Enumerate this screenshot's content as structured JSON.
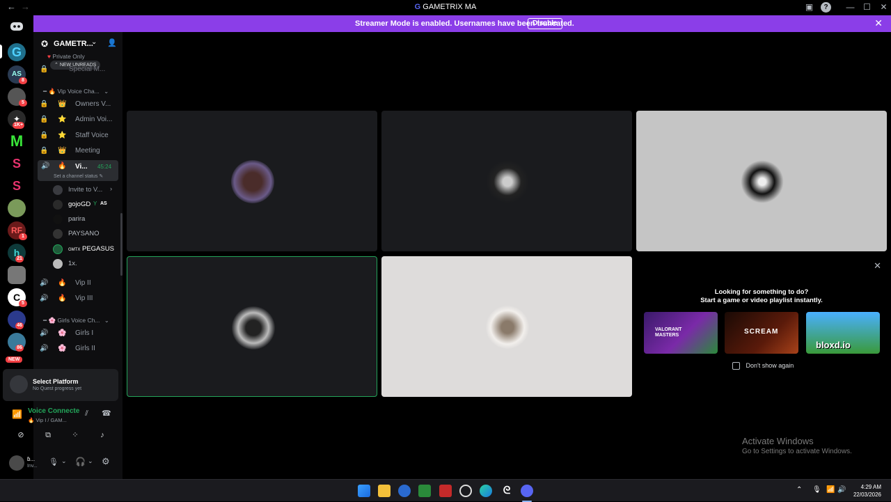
{
  "titlebar": {
    "title": "GAMETRIX MA"
  },
  "banner": {
    "message": "Streamer Mode is enabled. Usernames have been truncated.",
    "disable_label": "Disable"
  },
  "rail": {
    "badges": [
      "8",
      "5",
      "1K+",
      "1",
      "21",
      "5",
      "46",
      "86"
    ],
    "new_label": "NEW"
  },
  "sidebar": {
    "guild_name": "GAMETR...",
    "private_cat": "Private Only",
    "new_unreads": "NEW UNREADS",
    "special_ch": "Special M...",
    "vip_voice_cat": "Vip Voice Cha...",
    "channels": [
      {
        "label": "Owners V...",
        "emoji": "👑"
      },
      {
        "label": "Admin Voi...",
        "emoji": "⭐"
      },
      {
        "label": "Staff Voice",
        "emoji": "⭐"
      },
      {
        "label": "Meeting",
        "emoji": "👑"
      }
    ],
    "active_channel": {
      "label": "Vi...",
      "timer": "45:24",
      "status": "Set a channel status"
    },
    "invite_label": "Invite to V...",
    "members": [
      {
        "name": "gojoGD",
        "tag": "AS"
      },
      {
        "name": "parira"
      },
      {
        "name": "PAYSANO"
      },
      {
        "name": "PEGASUS",
        "prefix": "GMTX"
      },
      {
        "name": "1x."
      }
    ],
    "more_channels": [
      {
        "label": "Vip II"
      },
      {
        "label": "Vip III"
      }
    ],
    "girls_cat": "Girls Voice Ch...",
    "girls_channels": [
      {
        "label": "Girls I"
      },
      {
        "label": "Girls II"
      }
    ]
  },
  "userpanel": {
    "quest_title": "Select Platform",
    "quest_sub": "No Quest progress yet",
    "voice_status": "Voice Connecte",
    "voice_sub": "Vip I / GAM...",
    "user_name": "ɓ...",
    "user_status": "Inv..."
  },
  "activity": {
    "line1": "Looking for something to do?",
    "line2": "Start a game or video playlist instantly.",
    "games": [
      "VALORANT MASTERS",
      "SCREAM",
      "bloxd.io"
    ],
    "dont_show": "Don't show again"
  },
  "watermark": {
    "line1": "Activate Windows",
    "line2": "Go to Settings to activate Windows."
  },
  "clock": {
    "time": "4:29 AM",
    "date": "22/03/2026"
  },
  "colors": {
    "accent": "#8b3ee8",
    "discord": "#5865f2",
    "green": "#23a55a"
  }
}
